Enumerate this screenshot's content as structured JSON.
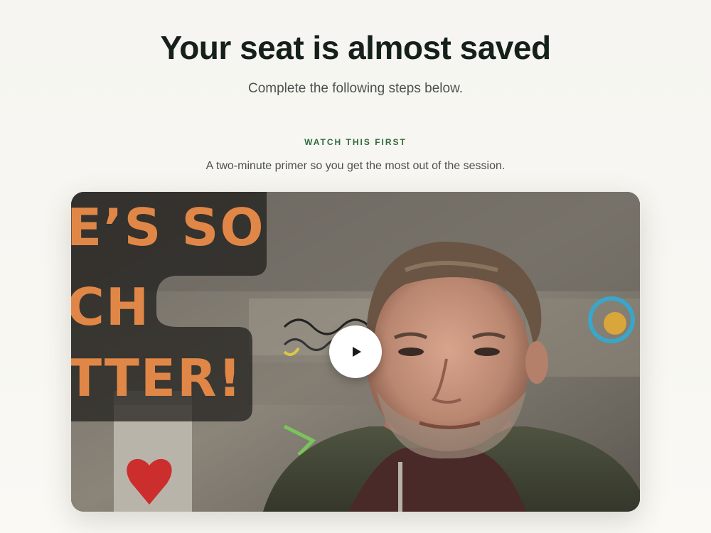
{
  "header": {
    "title": "Your seat is almost saved",
    "subtitle": "Complete the following steps below."
  },
  "primer_section": {
    "eyebrow": "WATCH THIS FIRST",
    "description": "A two-minute primer so you get the most out of the session."
  },
  "video": {
    "overlay_lines": [
      "E’S SO",
      "CH",
      "TTER!"
    ],
    "play_icon": "play-icon",
    "overlay_text_color": "#e08747",
    "overlay_panel_color": "#1f1d1b"
  },
  "colors": {
    "background": "#f7f6f1",
    "heading": "#16201a",
    "eyebrow": "#2f6b3d",
    "body_text": "#4c524e"
  }
}
